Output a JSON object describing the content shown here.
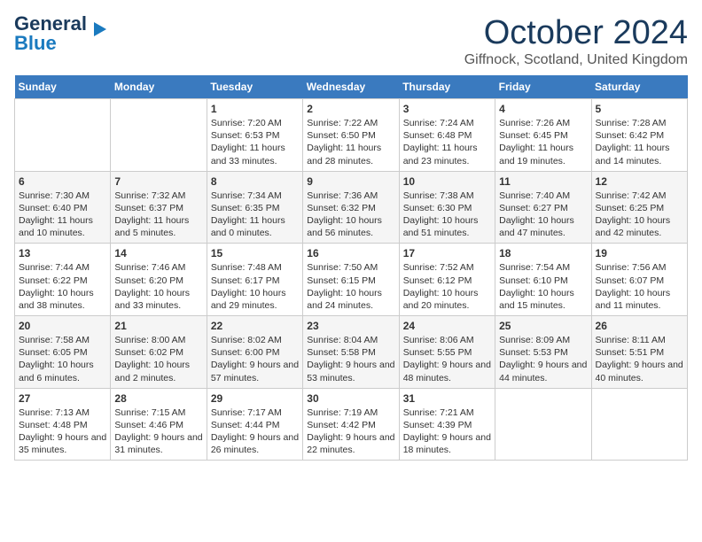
{
  "header": {
    "logo_line1": "General",
    "logo_line2": "Blue",
    "month": "October 2024",
    "location": "Giffnock, Scotland, United Kingdom"
  },
  "days_of_week": [
    "Sunday",
    "Monday",
    "Tuesday",
    "Wednesday",
    "Thursday",
    "Friday",
    "Saturday"
  ],
  "weeks": [
    [
      {
        "day": "",
        "content": ""
      },
      {
        "day": "",
        "content": ""
      },
      {
        "day": "1",
        "content": "Sunrise: 7:20 AM\nSunset: 6:53 PM\nDaylight: 11 hours and 33 minutes."
      },
      {
        "day": "2",
        "content": "Sunrise: 7:22 AM\nSunset: 6:50 PM\nDaylight: 11 hours and 28 minutes."
      },
      {
        "day": "3",
        "content": "Sunrise: 7:24 AM\nSunset: 6:48 PM\nDaylight: 11 hours and 23 minutes."
      },
      {
        "day": "4",
        "content": "Sunrise: 7:26 AM\nSunset: 6:45 PM\nDaylight: 11 hours and 19 minutes."
      },
      {
        "day": "5",
        "content": "Sunrise: 7:28 AM\nSunset: 6:42 PM\nDaylight: 11 hours and 14 minutes."
      }
    ],
    [
      {
        "day": "6",
        "content": "Sunrise: 7:30 AM\nSunset: 6:40 PM\nDaylight: 11 hours and 10 minutes."
      },
      {
        "day": "7",
        "content": "Sunrise: 7:32 AM\nSunset: 6:37 PM\nDaylight: 11 hours and 5 minutes."
      },
      {
        "day": "8",
        "content": "Sunrise: 7:34 AM\nSunset: 6:35 PM\nDaylight: 11 hours and 0 minutes."
      },
      {
        "day": "9",
        "content": "Sunrise: 7:36 AM\nSunset: 6:32 PM\nDaylight: 10 hours and 56 minutes."
      },
      {
        "day": "10",
        "content": "Sunrise: 7:38 AM\nSunset: 6:30 PM\nDaylight: 10 hours and 51 minutes."
      },
      {
        "day": "11",
        "content": "Sunrise: 7:40 AM\nSunset: 6:27 PM\nDaylight: 10 hours and 47 minutes."
      },
      {
        "day": "12",
        "content": "Sunrise: 7:42 AM\nSunset: 6:25 PM\nDaylight: 10 hours and 42 minutes."
      }
    ],
    [
      {
        "day": "13",
        "content": "Sunrise: 7:44 AM\nSunset: 6:22 PM\nDaylight: 10 hours and 38 minutes."
      },
      {
        "day": "14",
        "content": "Sunrise: 7:46 AM\nSunset: 6:20 PM\nDaylight: 10 hours and 33 minutes."
      },
      {
        "day": "15",
        "content": "Sunrise: 7:48 AM\nSunset: 6:17 PM\nDaylight: 10 hours and 29 minutes."
      },
      {
        "day": "16",
        "content": "Sunrise: 7:50 AM\nSunset: 6:15 PM\nDaylight: 10 hours and 24 minutes."
      },
      {
        "day": "17",
        "content": "Sunrise: 7:52 AM\nSunset: 6:12 PM\nDaylight: 10 hours and 20 minutes."
      },
      {
        "day": "18",
        "content": "Sunrise: 7:54 AM\nSunset: 6:10 PM\nDaylight: 10 hours and 15 minutes."
      },
      {
        "day": "19",
        "content": "Sunrise: 7:56 AM\nSunset: 6:07 PM\nDaylight: 10 hours and 11 minutes."
      }
    ],
    [
      {
        "day": "20",
        "content": "Sunrise: 7:58 AM\nSunset: 6:05 PM\nDaylight: 10 hours and 6 minutes."
      },
      {
        "day": "21",
        "content": "Sunrise: 8:00 AM\nSunset: 6:02 PM\nDaylight: 10 hours and 2 minutes."
      },
      {
        "day": "22",
        "content": "Sunrise: 8:02 AM\nSunset: 6:00 PM\nDaylight: 9 hours and 57 minutes."
      },
      {
        "day": "23",
        "content": "Sunrise: 8:04 AM\nSunset: 5:58 PM\nDaylight: 9 hours and 53 minutes."
      },
      {
        "day": "24",
        "content": "Sunrise: 8:06 AM\nSunset: 5:55 PM\nDaylight: 9 hours and 48 minutes."
      },
      {
        "day": "25",
        "content": "Sunrise: 8:09 AM\nSunset: 5:53 PM\nDaylight: 9 hours and 44 minutes."
      },
      {
        "day": "26",
        "content": "Sunrise: 8:11 AM\nSunset: 5:51 PM\nDaylight: 9 hours and 40 minutes."
      }
    ],
    [
      {
        "day": "27",
        "content": "Sunrise: 7:13 AM\nSunset: 4:48 PM\nDaylight: 9 hours and 35 minutes."
      },
      {
        "day": "28",
        "content": "Sunrise: 7:15 AM\nSunset: 4:46 PM\nDaylight: 9 hours and 31 minutes."
      },
      {
        "day": "29",
        "content": "Sunrise: 7:17 AM\nSunset: 4:44 PM\nDaylight: 9 hours and 26 minutes."
      },
      {
        "day": "30",
        "content": "Sunrise: 7:19 AM\nSunset: 4:42 PM\nDaylight: 9 hours and 22 minutes."
      },
      {
        "day": "31",
        "content": "Sunrise: 7:21 AM\nSunset: 4:39 PM\nDaylight: 9 hours and 18 minutes."
      },
      {
        "day": "",
        "content": ""
      },
      {
        "day": "",
        "content": ""
      }
    ]
  ]
}
